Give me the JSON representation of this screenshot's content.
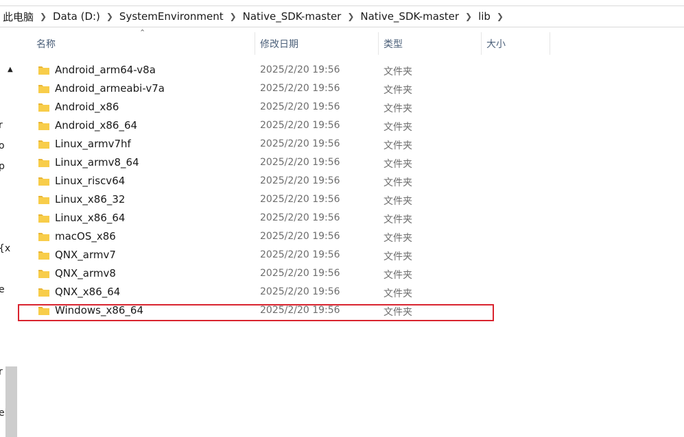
{
  "breadcrumb": [
    "此电脑",
    "Data (D:)",
    "SystemEnvironment",
    "Native_SDK-master",
    "Native_SDK-master",
    "lib"
  ],
  "breadcrumb_separator_icon": "chevron-right-icon",
  "columns": {
    "name": "名称",
    "date": "修改日期",
    "type": "类型",
    "size": "大小"
  },
  "nav_pane_letters": [
    "r",
    "o",
    "p",
    "{x",
    "e",
    "r",
    "el"
  ],
  "files": [
    {
      "name": "Android_arm64-v8a",
      "date": "2025/2/20 19:56",
      "type": "文件夹"
    },
    {
      "name": "Android_armeabi-v7a",
      "date": "2025/2/20 19:56",
      "type": "文件夹"
    },
    {
      "name": "Android_x86",
      "date": "2025/2/20 19:56",
      "type": "文件夹"
    },
    {
      "name": "Android_x86_64",
      "date": "2025/2/20 19:56",
      "type": "文件夹"
    },
    {
      "name": "Linux_armv7hf",
      "date": "2025/2/20 19:56",
      "type": "文件夹"
    },
    {
      "name": "Linux_armv8_64",
      "date": "2025/2/20 19:56",
      "type": "文件夹"
    },
    {
      "name": "Linux_riscv64",
      "date": "2025/2/20 19:56",
      "type": "文件夹"
    },
    {
      "name": "Linux_x86_32",
      "date": "2025/2/20 19:56",
      "type": "文件夹"
    },
    {
      "name": "Linux_x86_64",
      "date": "2025/2/20 19:56",
      "type": "文件夹"
    },
    {
      "name": "macOS_x86",
      "date": "2025/2/20 19:56",
      "type": "文件夹"
    },
    {
      "name": "QNX_armv7",
      "date": "2025/2/20 19:56",
      "type": "文件夹"
    },
    {
      "name": "QNX_armv8",
      "date": "2025/2/20 19:56",
      "type": "文件夹"
    },
    {
      "name": "QNX_x86_64",
      "date": "2025/2/20 19:56",
      "type": "文件夹"
    },
    {
      "name": "Windows_x86_64",
      "date": "2025/2/20 19:56",
      "type": "文件夹"
    }
  ],
  "highlighted_file": "Windows_x86_64",
  "colors": {
    "folder": "#f8cd4a",
    "folder_dark": "#e8b435",
    "highlight": "#d9232e",
    "header_text": "#4c607a"
  }
}
